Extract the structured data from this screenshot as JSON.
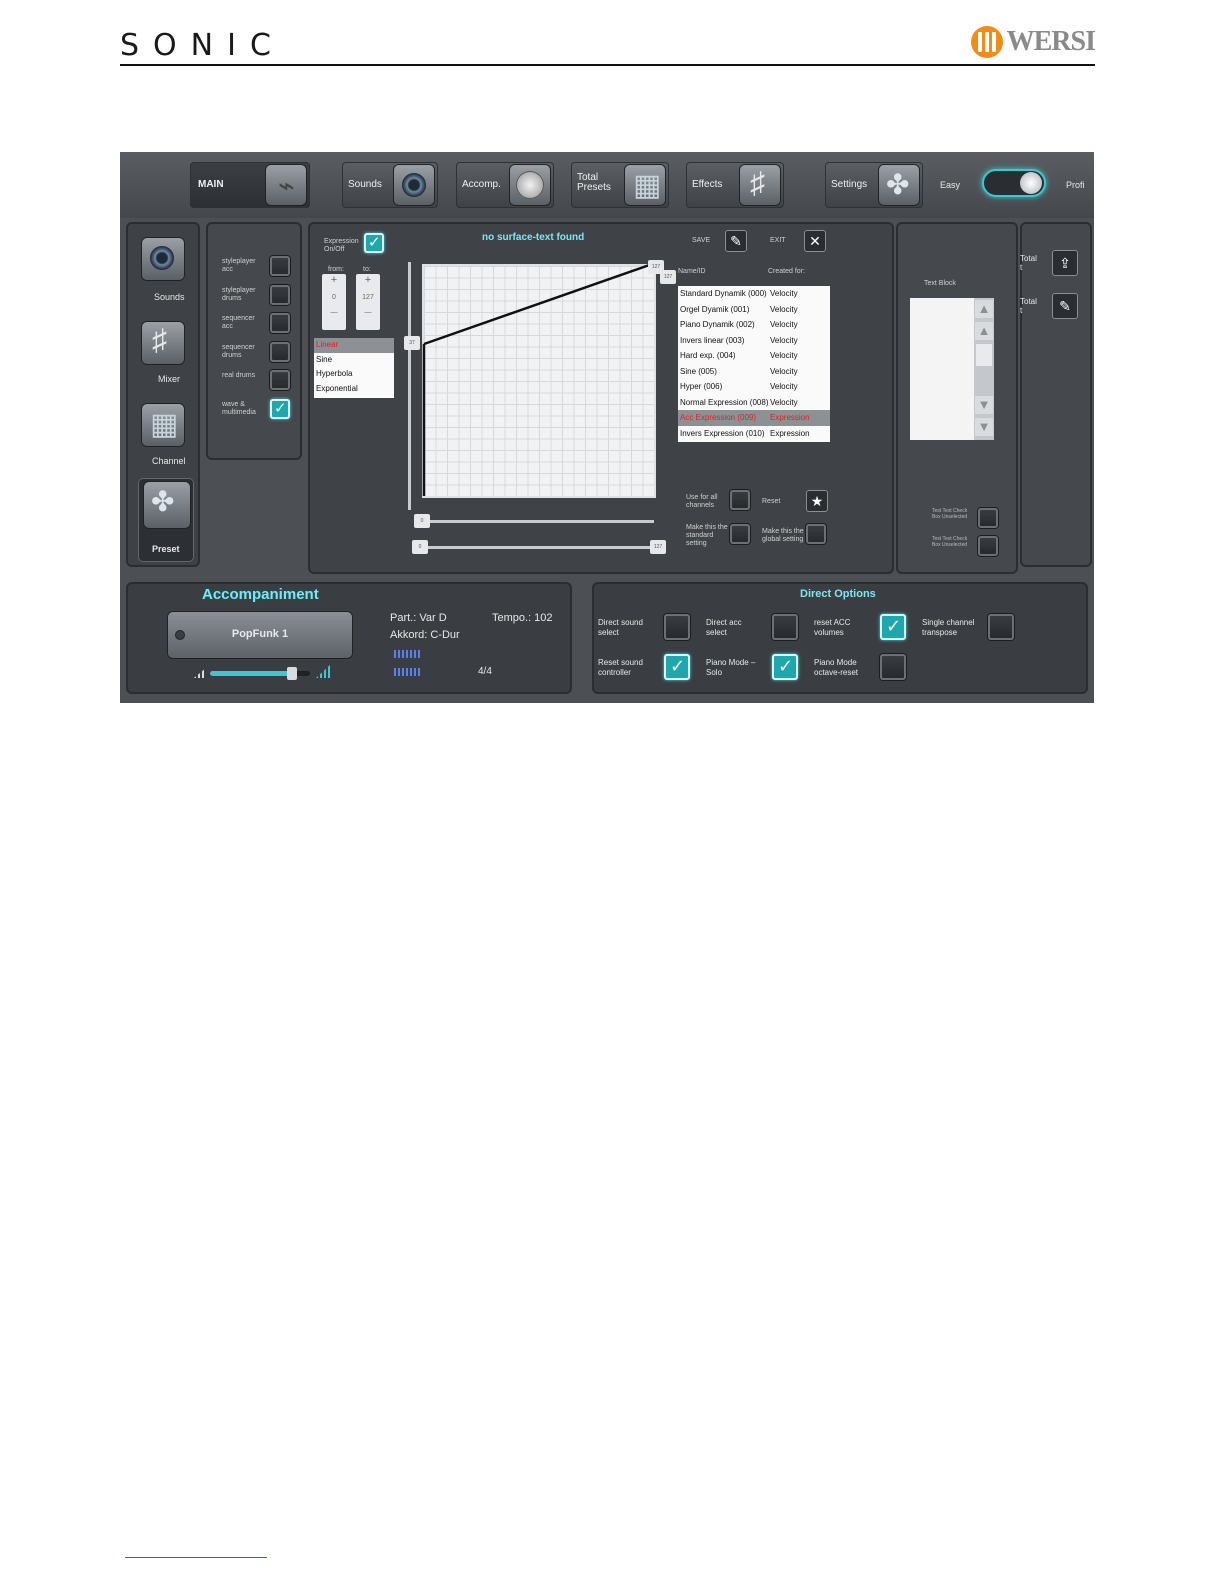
{
  "doc": {
    "brand_left": "SONIC",
    "brand_right": "WERSI"
  },
  "nav": {
    "main": "MAIN",
    "sounds": "Sounds",
    "accomp": "Accomp.",
    "total_presets": "Total\nPresets",
    "effects": "Effects",
    "settings": "Settings",
    "mode_easy": "Easy",
    "mode_profi": "Profi"
  },
  "sidebar": {
    "sounds": "Sounds",
    "mixer": "Mixer",
    "channel": "Channel",
    "preset": "Preset"
  },
  "options": {
    "items": [
      {
        "label": "styleplayer acc",
        "checked": false
      },
      {
        "label": "styleplayer drums",
        "checked": false
      },
      {
        "label": "sequencer acc",
        "checked": false
      },
      {
        "label": "sequencer drums",
        "checked": false
      },
      {
        "label": "real drums",
        "checked": false
      },
      {
        "label": "wave & multimedia",
        "checked": true
      }
    ]
  },
  "editor": {
    "expression_label": "Expression On/Off",
    "title": "no surface-text found",
    "save": "SAVE",
    "exit": "EXIT",
    "from_label": "from:",
    "to_label": "to:",
    "from_value": "0",
    "to_value": "127",
    "plus": "+",
    "minus": "—",
    "curve_types": [
      "Linear",
      "Sine",
      "Hyperbola",
      "Exponential"
    ],
    "selected_curve": "Linear",
    "col_name": "Name/ID",
    "col_created": "Created for:",
    "curves": [
      {
        "name": "Standard Dynamik (000)",
        "for": "Velocity"
      },
      {
        "name": "Orgel Dyamik (001)",
        "for": "Velocity"
      },
      {
        "name": "Piano Dynamik (002)",
        "for": "Velocity"
      },
      {
        "name": "Invers linear (003)",
        "for": "Velocity"
      },
      {
        "name": "Hard exp. (004)",
        "for": "Velocity"
      },
      {
        "name": "Sine (005)",
        "for": "Velocity"
      },
      {
        "name": "Hyper (006)",
        "for": "Velocity"
      },
      {
        "name": "Normal Expression (008)",
        "for": "Velocity"
      },
      {
        "name": "Acc Expression (009)",
        "for": "Expression"
      },
      {
        "name": "Invers Expression (010)",
        "for": "Expression"
      }
    ],
    "use_all_channels": "Use for all channels",
    "reset": "Reset",
    "make_standard": "Make this the standard setting",
    "make_global": "Make this the global setting",
    "handle_top_left": "127",
    "handle_top_right": "127",
    "handle_left": "37",
    "handle_bottom": "0",
    "handle_rail_left": "0",
    "handle_rail_right": "127"
  },
  "textblock": {
    "label": "Text Block",
    "check1": "Test Text Check Box Unselected",
    "check2": "Test Text Check Box Unselected"
  },
  "rightcol": {
    "item1": "Total\nt",
    "item2": "Total\nt"
  },
  "accompaniment": {
    "title": "Accompaniment",
    "style": "PopFunk 1",
    "part": "Part.: Var D",
    "tempo": "Tempo.: 102",
    "chord": "Akkord: C-Dur",
    "meter": "4/4",
    "volume_level": 0.82
  },
  "direct": {
    "title": "Direct Options",
    "items": [
      {
        "label": "Direct sound\nselect",
        "checked": false
      },
      {
        "label": "Direct acc\nselect",
        "checked": false
      },
      {
        "label": "reset ACC\nvolumes",
        "checked": true
      },
      {
        "label": "Single channel\ntranspose",
        "checked": false
      },
      {
        "label": "Reset sound\ncontroller",
        "checked": true
      },
      {
        "label": "Piano Mode –\nSolo",
        "checked": true
      },
      {
        "label": "Piano Mode\noctave-reset",
        "checked": false
      }
    ]
  },
  "colors": {
    "accent": "#3fc6cf",
    "panel": "#3e4246",
    "bg": "#4c5054",
    "selected_text": "#e02020"
  }
}
